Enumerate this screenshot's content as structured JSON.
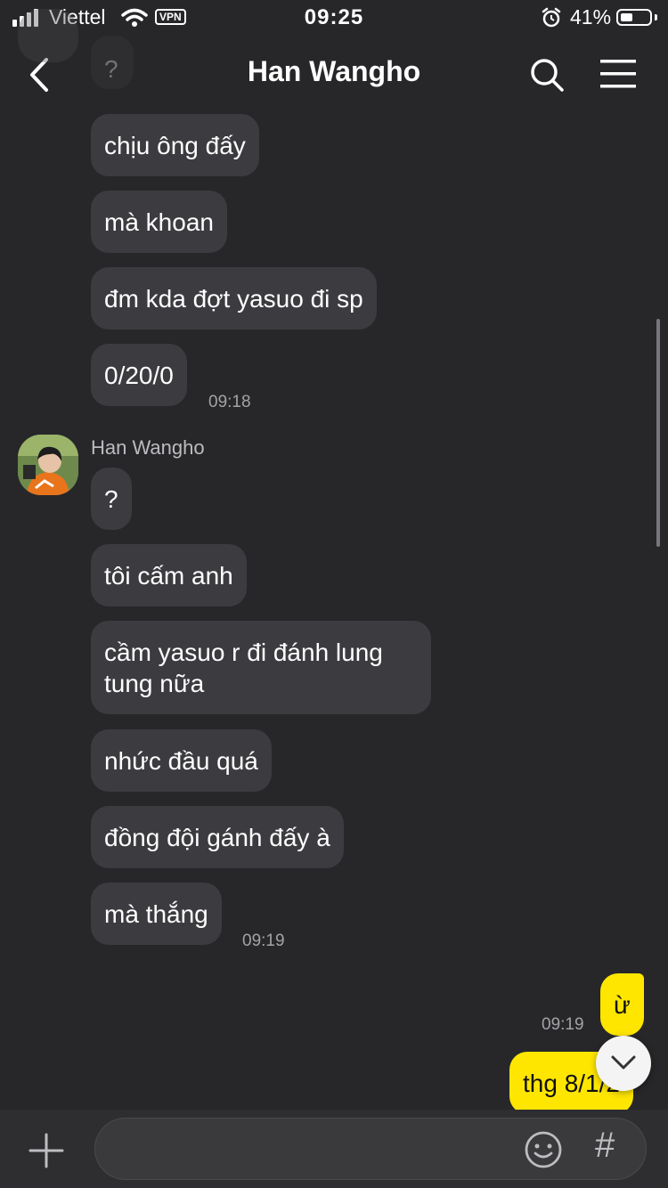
{
  "status_bar": {
    "carrier": "Viettel",
    "vpn": "VPN",
    "time": "09:25",
    "battery": "41%"
  },
  "header": {
    "title": "Han Wangho",
    "back_icon": "chevron-left-icon",
    "search_icon": "search-icon",
    "menu_icon": "hamburger-menu-icon"
  },
  "messages": {
    "partial_top": "?",
    "m1": "chịu ông đấy",
    "m2": "mà khoan",
    "m3": "đm kda đợt yasuo đi sp",
    "m4": "0/20/0",
    "t1": "09:18",
    "sender": "Han Wangho",
    "m5": "?",
    "m6": "tôi cấm anh",
    "m7": "cầm yasuo r đi đánh lung tung nữa",
    "m8": "nhức đầu quá",
    "m9": "đồng đội gánh đấy à",
    "m10": "mà thắng",
    "t2": "09:19",
    "mine1": "ừ",
    "t3": "09:19",
    "mine2": "thg 8/1/2"
  },
  "input": {
    "emoji_icon": "smiley-icon",
    "hashtag": "#",
    "add_icon": "plus-icon"
  },
  "colors": {
    "background": "#27272a",
    "bubble_received": "#3c3c40",
    "bubble_sent": "#ffe600"
  }
}
